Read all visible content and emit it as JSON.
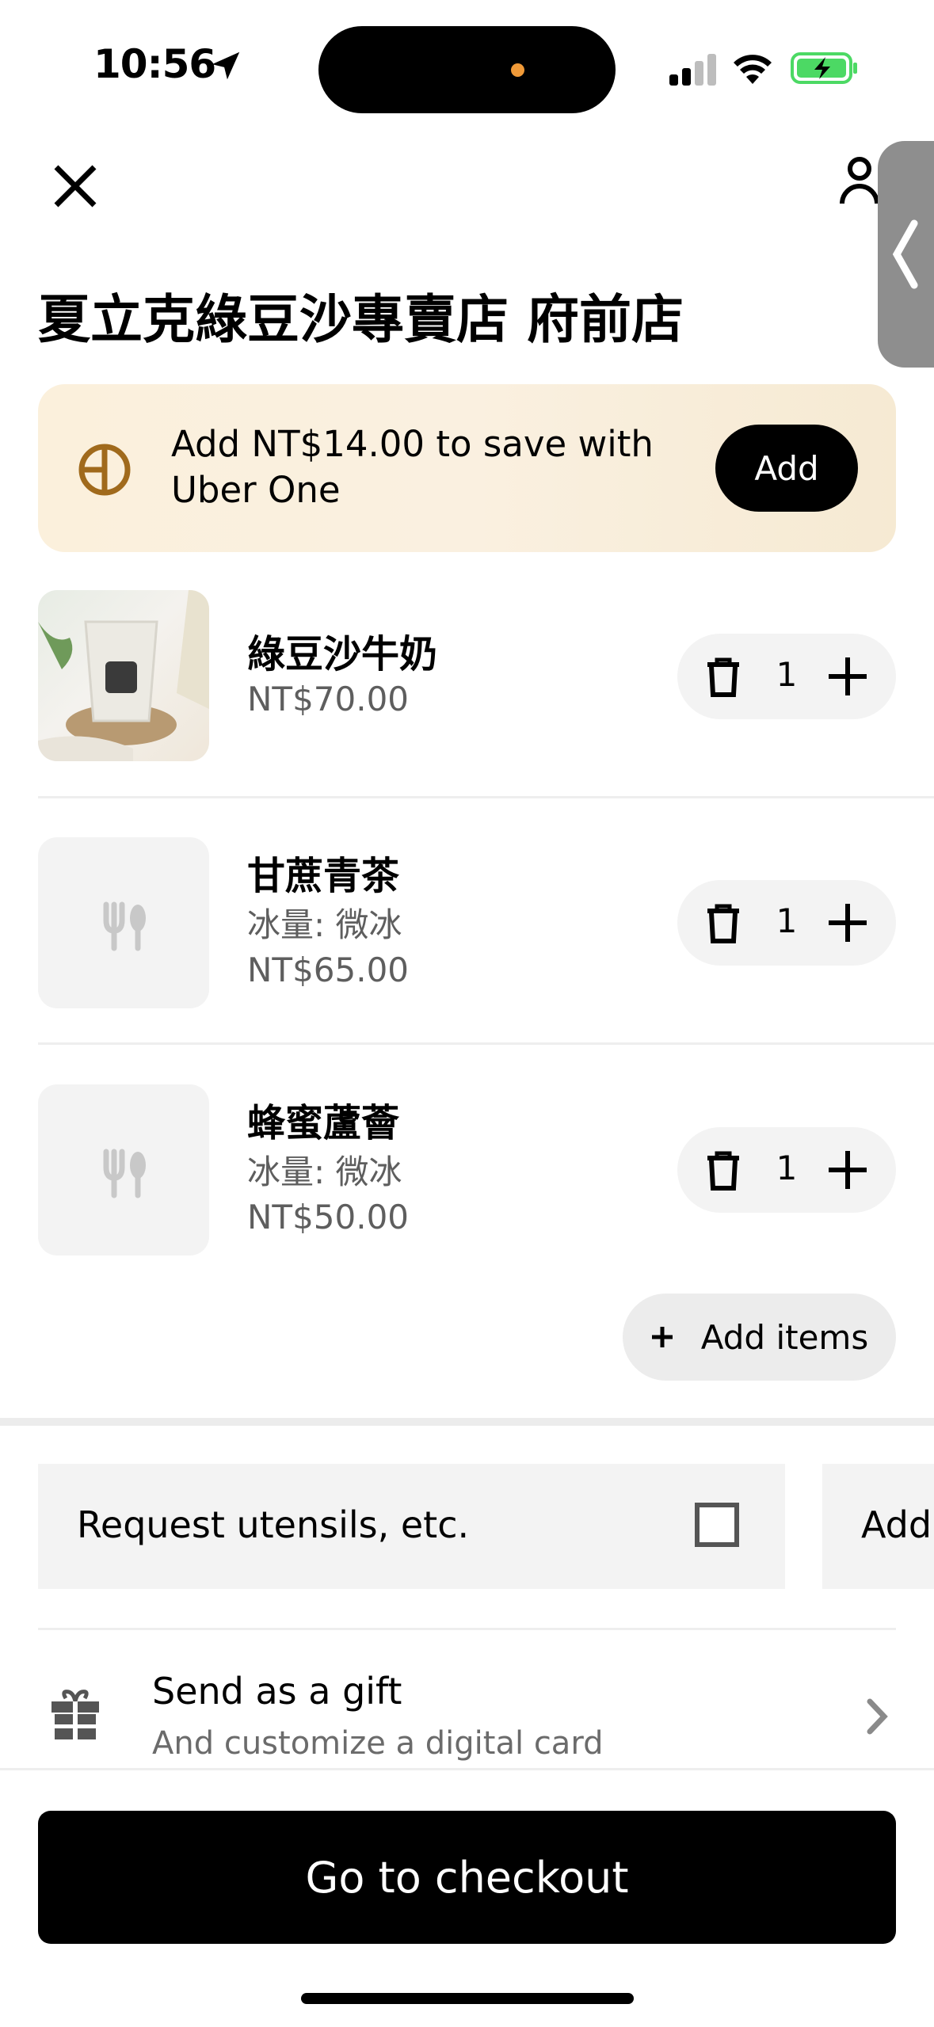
{
  "status_bar": {
    "time": "10:56"
  },
  "header": {
    "store_title": "夏立克綠豆沙專賣店 府前店"
  },
  "promo": {
    "text": "Add NT$14.00 to save with Uber One",
    "button_label": "Add"
  },
  "cart_items": [
    {
      "name": "綠豆沙牛奶",
      "option": "",
      "price": "NT$70.00",
      "quantity": "1"
    },
    {
      "name": "甘蔗青茶",
      "option": "冰量: 微冰",
      "price": "NT$65.00",
      "quantity": "1"
    },
    {
      "name": "蜂蜜蘆薈",
      "option": "冰量: 微冰",
      "price": "NT$50.00",
      "quantity": "1"
    }
  ],
  "add_items_label": "Add items",
  "options": {
    "utensils_label": "Request utensils, etc.",
    "note_label": "Add"
  },
  "gift": {
    "title": "Send as a gift",
    "subtitle": "And customize a digital card"
  },
  "checkout_label": "Go to checkout",
  "colors": {
    "promo_bg": "#f9eedc",
    "accent_orange": "#f09a38",
    "uber_one_gold": "#a06a1c",
    "battery_green": "#4cd964"
  }
}
